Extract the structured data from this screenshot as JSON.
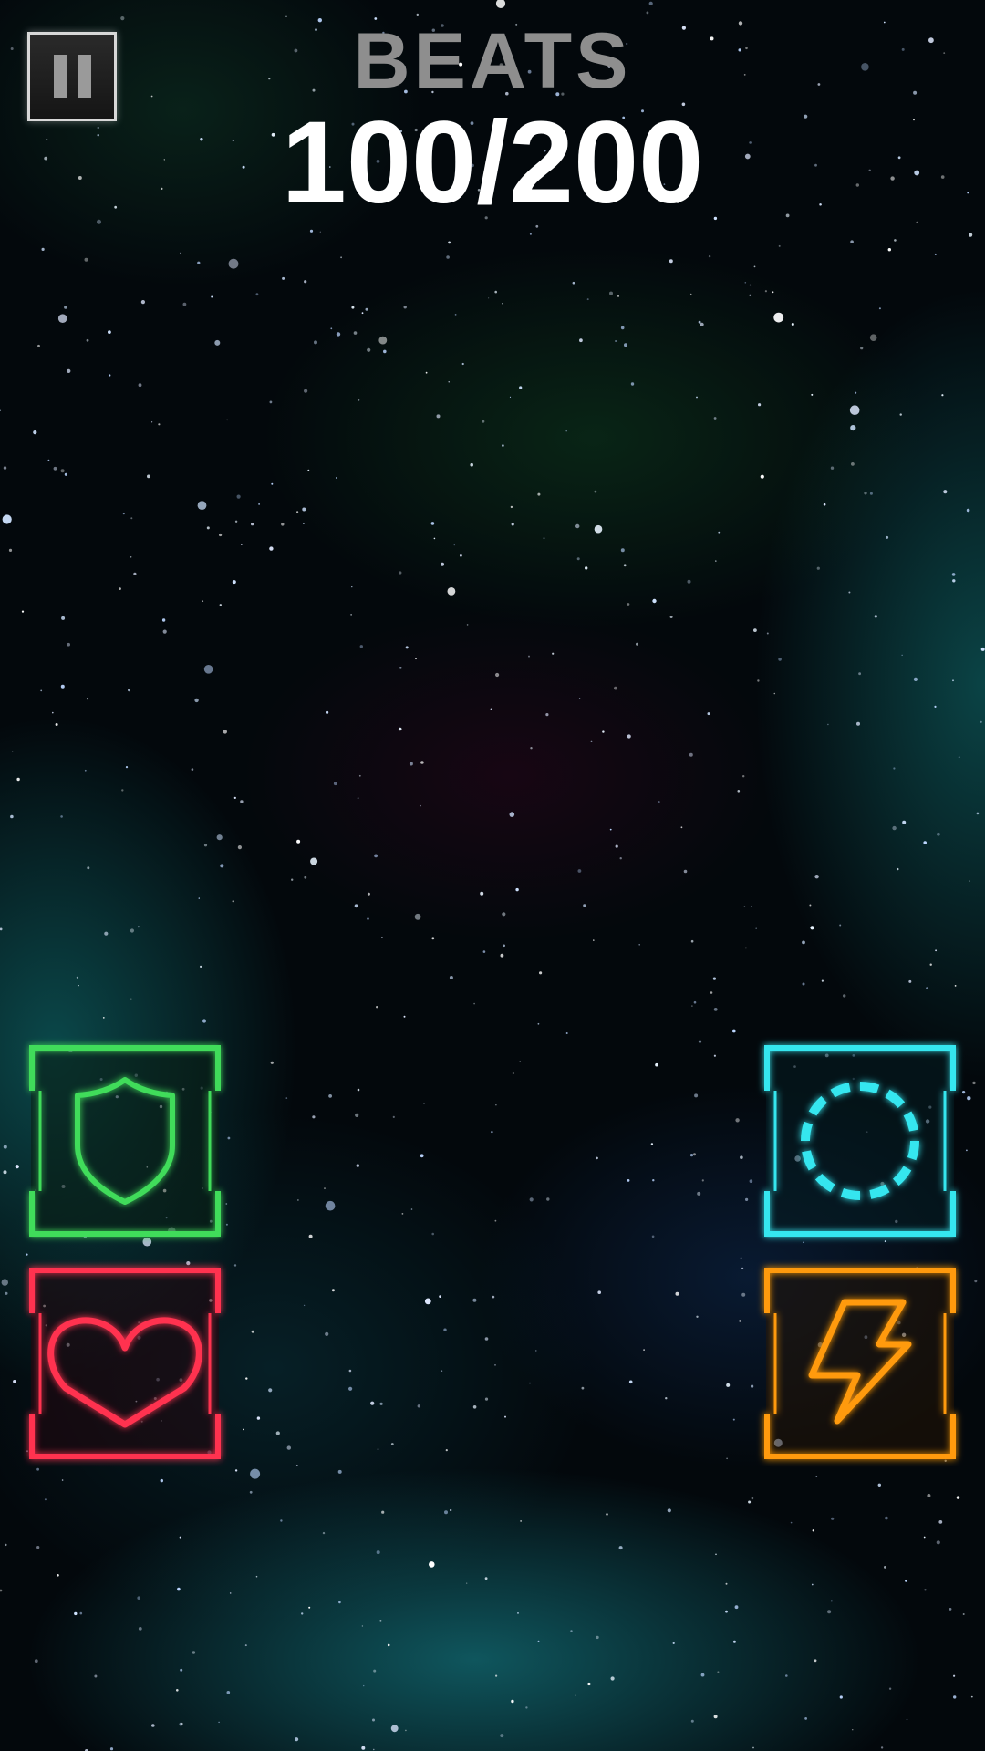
{
  "hud": {
    "label": "BEATS",
    "beats_current": "100",
    "beats_total": "200",
    "beats_display": "100/200"
  },
  "pause_button": {
    "icon": "pause-icon"
  },
  "powerups": [
    {
      "id": "shield",
      "icon": "shield-icon",
      "color": "#3fdc5a"
    },
    {
      "id": "slow",
      "icon": "dashed-circle-icon",
      "color": "#35e6ef"
    },
    {
      "id": "heart",
      "icon": "heart-icon",
      "color": "#ff3350"
    },
    {
      "id": "bolt",
      "icon": "lightning-bolt-icon",
      "color": "#ff9a10"
    }
  ],
  "background": {
    "accent_teal": "#1fa6a8",
    "accent_green": "#1e6b3a"
  }
}
